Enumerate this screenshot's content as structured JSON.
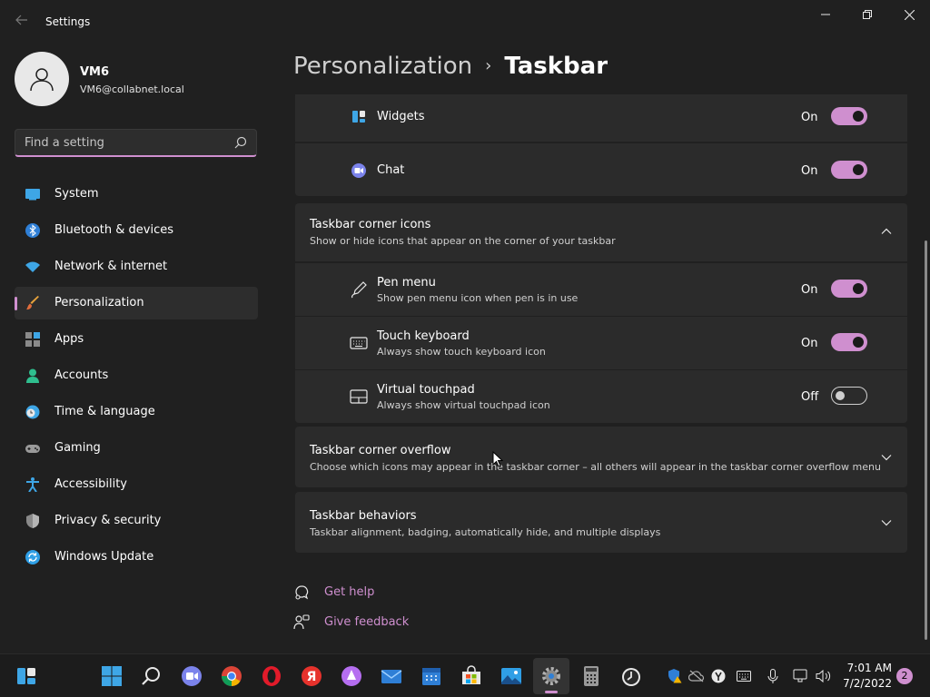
{
  "window": {
    "title": "Settings"
  },
  "profile": {
    "name": "VM6",
    "email": "VM6@collabnet.local"
  },
  "search": {
    "placeholder": "Find a setting"
  },
  "sidebar": {
    "items": [
      {
        "label": "System",
        "icon": "system-icon"
      },
      {
        "label": "Bluetooth & devices",
        "icon": "bluetooth-icon"
      },
      {
        "label": "Network & internet",
        "icon": "wifi-icon"
      },
      {
        "label": "Personalization",
        "icon": "brush-icon",
        "active": true
      },
      {
        "label": "Apps",
        "icon": "apps-icon"
      },
      {
        "label": "Accounts",
        "icon": "account-icon"
      },
      {
        "label": "Time & language",
        "icon": "clock-globe-icon"
      },
      {
        "label": "Gaming",
        "icon": "gamepad-icon"
      },
      {
        "label": "Accessibility",
        "icon": "accessibility-icon"
      },
      {
        "label": "Privacy & security",
        "icon": "shield-icon"
      },
      {
        "label": "Windows Update",
        "icon": "update-icon"
      }
    ]
  },
  "breadcrumb": {
    "parent": "Personalization",
    "separator": "›",
    "current": "Taskbar"
  },
  "taskbar_items": {
    "widgets": {
      "label": "Widgets",
      "state": "On"
    },
    "chat": {
      "label": "Chat",
      "state": "On"
    }
  },
  "corner_icons": {
    "title": "Taskbar corner icons",
    "subtitle": "Show or hide icons that appear on the corner of your taskbar",
    "items": [
      {
        "title": "Pen menu",
        "subtitle": "Show pen menu icon when pen is in use",
        "state": "On",
        "on": true
      },
      {
        "title": "Touch keyboard",
        "subtitle": "Always show touch keyboard icon",
        "state": "On",
        "on": true
      },
      {
        "title": "Virtual touchpad",
        "subtitle": "Always show virtual touchpad icon",
        "state": "Off",
        "on": false
      }
    ]
  },
  "corner_overflow": {
    "title": "Taskbar corner overflow",
    "subtitle": "Choose which icons may appear in the taskbar corner – all others will appear in the taskbar corner overflow menu"
  },
  "behaviors": {
    "title": "Taskbar behaviors",
    "subtitle": "Taskbar alignment, badging, automatically hide, and multiple displays"
  },
  "links": {
    "help": "Get help",
    "feedback": "Give feedback"
  },
  "clock": {
    "time": "7:01 AM",
    "date": "7/2/2022"
  },
  "notifications": {
    "count": "2"
  },
  "colors": {
    "accent": "#cf8fcf",
    "background": "#202020",
    "card": "#2b2b2b"
  }
}
